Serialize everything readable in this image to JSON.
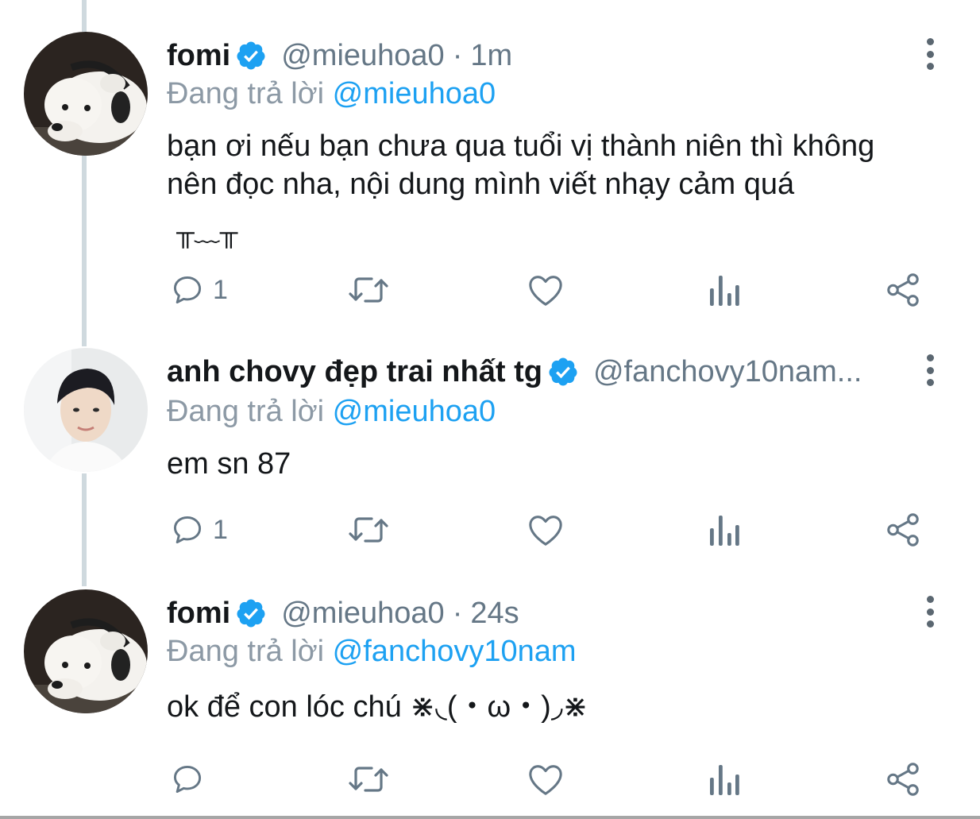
{
  "tweets": [
    {
      "name": "fomi",
      "handle": "@mieuhoa0",
      "separator": "·",
      "time": "1m",
      "reply_label": "Đang trả lời",
      "reply_to": "@mieuhoa0",
      "body_lines": [
        "bạn ơi nếu bạn chưa qua tuổi vị thành niên thì không",
        "nên đọc nha, nội dung mình viết nhạy cảm quá",
        "╥﹏╥"
      ],
      "reply_count": "1",
      "avatar": "dog-with-headphones"
    },
    {
      "name": "anh chovy đẹp trai nhất tg",
      "handle": "@fanchovy10nam...",
      "separator": "",
      "time": "",
      "reply_label": "Đang trả lời",
      "reply_to": "@mieuhoa0",
      "body_lines": [
        "em sn 87"
      ],
      "reply_count": "1",
      "avatar": "young-man-portrait"
    },
    {
      "name": "fomi",
      "handle": "@mieuhoa0",
      "separator": "·",
      "time": "24s",
      "reply_label": "Đang trả lời",
      "reply_to": "@fanchovy10nam",
      "body_lines": [
        "ok để con lóc chú ⋇◟(・ω・)◞⋇"
      ],
      "reply_count": "",
      "avatar": "dog-with-headphones"
    }
  ],
  "icons": {
    "verified": "verified-badge-icon",
    "reply": "reply-bubble-icon",
    "retweet": "retweet-icon",
    "like": "heart-icon",
    "analytics": "analytics-bars-icon",
    "share": "share-icon",
    "more": "more-vertical-icon"
  },
  "colors": {
    "link": "#1da1f2",
    "verified": "#1da1f2",
    "muted": "#657786",
    "thread_line": "#cfd9de"
  }
}
